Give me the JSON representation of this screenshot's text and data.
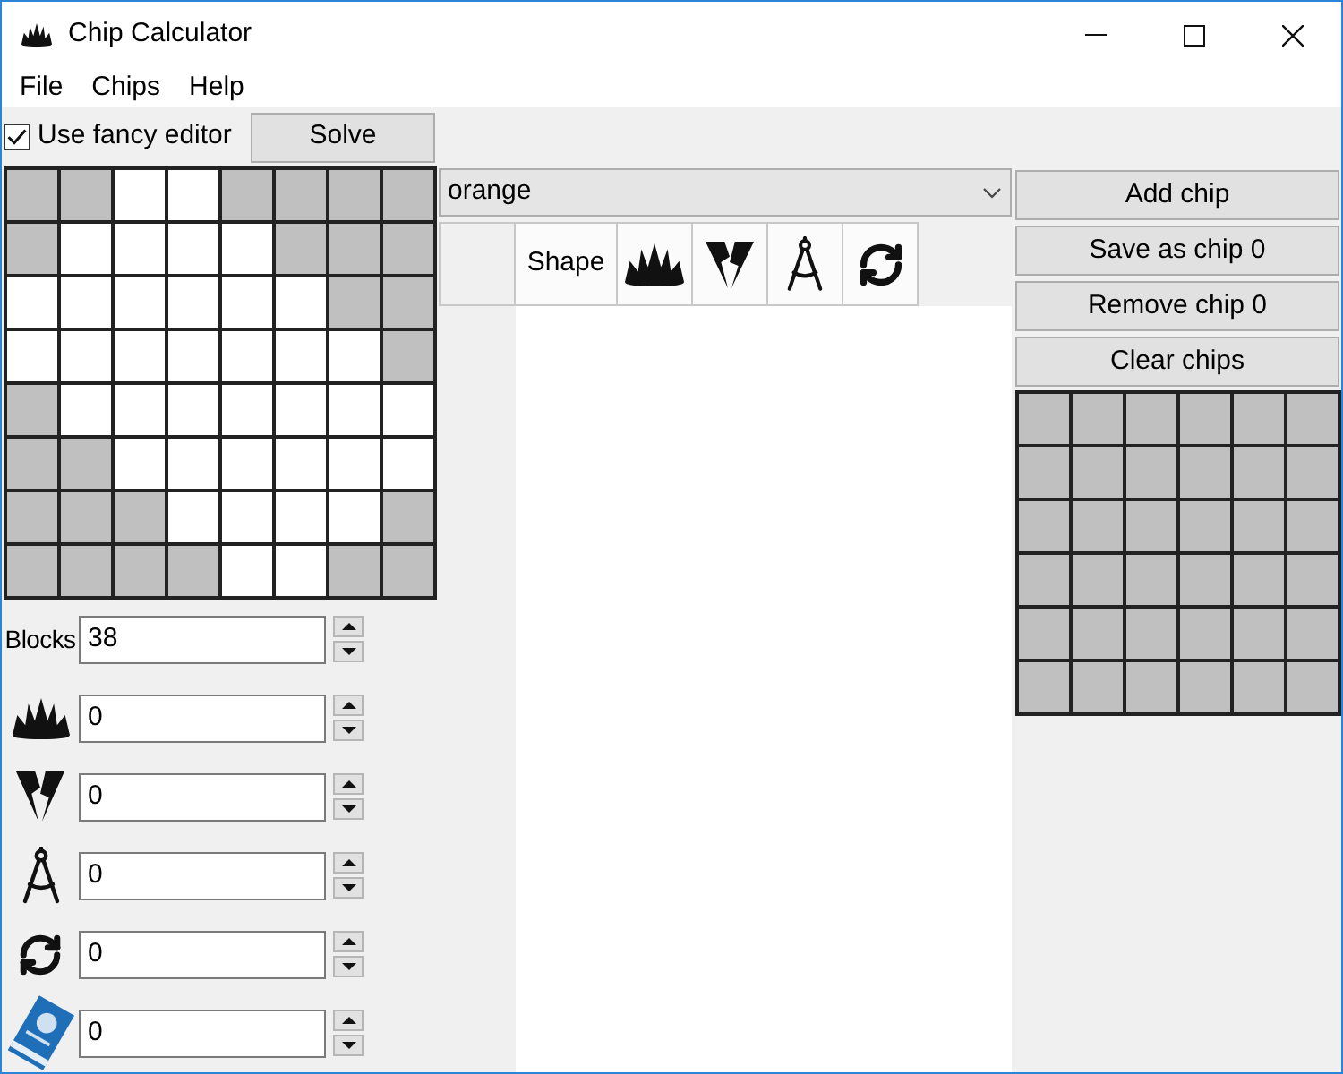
{
  "window": {
    "title": "Chip Calculator"
  },
  "menu": [
    "File",
    "Chips",
    "Help"
  ],
  "fancy_editor": {
    "label": "Use fancy editor",
    "checked": true
  },
  "solve_button": "Solve",
  "board": {
    "rows": [
      {
        "cells": [
          {
            "shaded": true
          },
          {
            "shaded": true
          },
          {
            "shaded": false
          },
          {
            "shaded": false
          },
          {
            "shaded": true
          },
          {
            "shaded": true
          },
          {
            "shaded": true
          },
          {
            "shaded": true
          }
        ]
      },
      {
        "cells": [
          {
            "shaded": true
          },
          {
            "shaded": false
          },
          {
            "shaded": false
          },
          {
            "shaded": false
          },
          {
            "shaded": false
          },
          {
            "shaded": true
          },
          {
            "shaded": true
          },
          {
            "shaded": true
          }
        ]
      },
      {
        "cells": [
          {
            "shaded": false
          },
          {
            "shaded": false
          },
          {
            "shaded": false
          },
          {
            "shaded": false
          },
          {
            "shaded": false
          },
          {
            "shaded": false
          },
          {
            "shaded": true
          },
          {
            "shaded": true
          }
        ]
      },
      {
        "cells": [
          {
            "shaded": false
          },
          {
            "shaded": false
          },
          {
            "shaded": false
          },
          {
            "shaded": false
          },
          {
            "shaded": false
          },
          {
            "shaded": false
          },
          {
            "shaded": false
          },
          {
            "shaded": true
          }
        ]
      },
      {
        "cells": [
          {
            "shaded": true
          },
          {
            "shaded": false
          },
          {
            "shaded": false
          },
          {
            "shaded": false
          },
          {
            "shaded": false
          },
          {
            "shaded": false
          },
          {
            "shaded": false
          },
          {
            "shaded": false
          }
        ]
      },
      {
        "cells": [
          {
            "shaded": true
          },
          {
            "shaded": true
          },
          {
            "shaded": false
          },
          {
            "shaded": false
          },
          {
            "shaded": false
          },
          {
            "shaded": false
          },
          {
            "shaded": false
          },
          {
            "shaded": false
          }
        ]
      },
      {
        "cells": [
          {
            "shaded": true
          },
          {
            "shaded": true
          },
          {
            "shaded": true
          },
          {
            "shaded": false
          },
          {
            "shaded": false
          },
          {
            "shaded": false
          },
          {
            "shaded": false
          },
          {
            "shaded": true
          }
        ]
      },
      {
        "cells": [
          {
            "shaded": true
          },
          {
            "shaded": true
          },
          {
            "shaded": true
          },
          {
            "shaded": true
          },
          {
            "shaded": false
          },
          {
            "shaded": false
          },
          {
            "shaded": true
          },
          {
            "shaded": true
          }
        ]
      }
    ]
  },
  "color_select": {
    "value": "orange"
  },
  "chip_table": {
    "columns": [
      {
        "kind": "label",
        "label": "Shape"
      },
      {
        "kind": "spikes"
      },
      {
        "kind": "bolt"
      },
      {
        "kind": "compass"
      },
      {
        "kind": "cycle"
      }
    ]
  },
  "chip_buttons": [
    "Add chip",
    "Save as chip 0",
    "Remove chip 0",
    "Clear chips"
  ],
  "chip_preview": {
    "rows": [
      {
        "cells": [
          {
            "shaded": true
          },
          {
            "shaded": true
          },
          {
            "shaded": true
          },
          {
            "shaded": true
          },
          {
            "shaded": true
          },
          {
            "shaded": true
          }
        ]
      },
      {
        "cells": [
          {
            "shaded": true
          },
          {
            "shaded": true
          },
          {
            "shaded": true
          },
          {
            "shaded": true
          },
          {
            "shaded": true
          },
          {
            "shaded": true
          }
        ]
      },
      {
        "cells": [
          {
            "shaded": true
          },
          {
            "shaded": true
          },
          {
            "shaded": true
          },
          {
            "shaded": true
          },
          {
            "shaded": true
          },
          {
            "shaded": true
          }
        ]
      },
      {
        "cells": [
          {
            "shaded": true
          },
          {
            "shaded": true
          },
          {
            "shaded": true
          },
          {
            "shaded": true
          },
          {
            "shaded": true
          },
          {
            "shaded": true
          }
        ]
      },
      {
        "cells": [
          {
            "shaded": true
          },
          {
            "shaded": true
          },
          {
            "shaded": true
          },
          {
            "shaded": true
          },
          {
            "shaded": true
          },
          {
            "shaded": true
          }
        ]
      },
      {
        "cells": [
          {
            "shaded": true
          },
          {
            "shaded": true
          },
          {
            "shaded": true
          },
          {
            "shaded": true
          },
          {
            "shaded": true
          },
          {
            "shaded": true
          }
        ]
      }
    ]
  },
  "stats": [
    {
      "kind": "label",
      "label": "Blocks",
      "value": "38"
    },
    {
      "kind": "spikes",
      "value": "0"
    },
    {
      "kind": "bolt",
      "value": "0"
    },
    {
      "kind": "compass",
      "value": "0"
    },
    {
      "kind": "cycle",
      "value": "0"
    },
    {
      "kind": "book",
      "value": "0"
    }
  ]
}
